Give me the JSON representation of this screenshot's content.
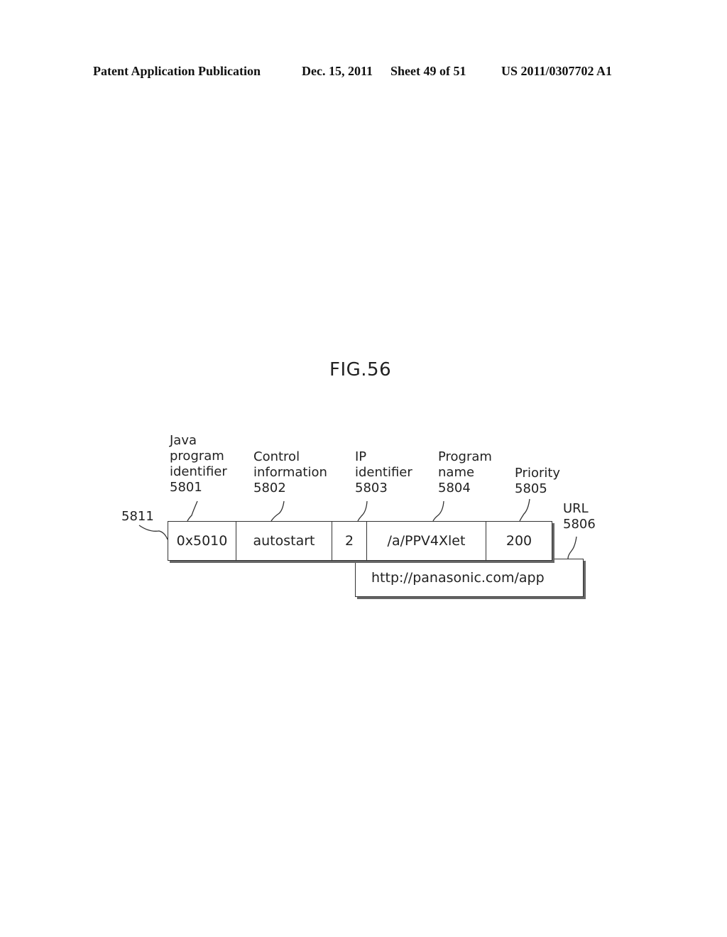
{
  "header": {
    "publication": "Patent Application Publication",
    "date": "Dec. 15, 2011",
    "sheet": "Sheet 49 of 51",
    "number": "US 2011/0307702 A1"
  },
  "figure": {
    "title": "FIG.56",
    "record_ref": "5811",
    "fields": [
      {
        "label_lines": [
          "Java",
          "program",
          "identifier"
        ],
        "ref": "5801",
        "value": "0x5010"
      },
      {
        "label_lines": [
          "Control",
          "information"
        ],
        "ref": "5802",
        "value": "autostart"
      },
      {
        "label_lines": [
          "IP",
          "identifier"
        ],
        "ref": "5803",
        "value": "2"
      },
      {
        "label_lines": [
          "Program",
          "name"
        ],
        "ref": "5804",
        "value": "/a/PPV4Xlet"
      },
      {
        "label_lines": [
          "Priority"
        ],
        "ref": "5805",
        "value": "200"
      },
      {
        "label_lines": [
          "URL"
        ],
        "ref": "5806",
        "value": "http://panasonic.com/app"
      }
    ]
  }
}
